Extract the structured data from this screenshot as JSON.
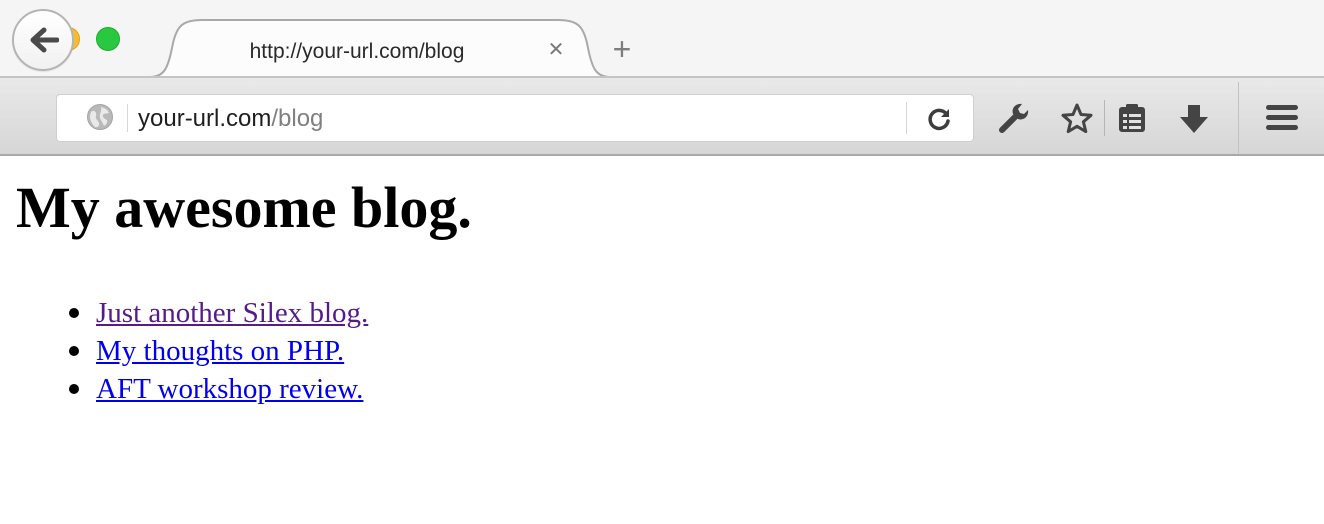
{
  "tab": {
    "title": "http://your-url.com/blog",
    "close_glyph": "✕",
    "new_tab_glyph": "+"
  },
  "urlbar": {
    "domain": "your-url.com",
    "path": "/blog"
  },
  "toolbar_icons": [
    "back-arrow-icon",
    "globe-icon",
    "reload-icon",
    "wrench-icon",
    "star-icon",
    "reading-list-icon",
    "download-icon",
    "menu-icon"
  ],
  "page": {
    "heading": "My awesome blog.",
    "posts": [
      {
        "title": "Just another Silex blog.",
        "visited": true
      },
      {
        "title": "My thoughts on PHP.",
        "visited": false
      },
      {
        "title": "AFT workshop review.",
        "visited": false
      }
    ]
  },
  "colors": {
    "link": "#0000ee",
    "visited_link": "#551a8b",
    "traffic_close": "#fc5f57",
    "traffic_minimize": "#fdbc2e",
    "traffic_maximize": "#28c840"
  }
}
